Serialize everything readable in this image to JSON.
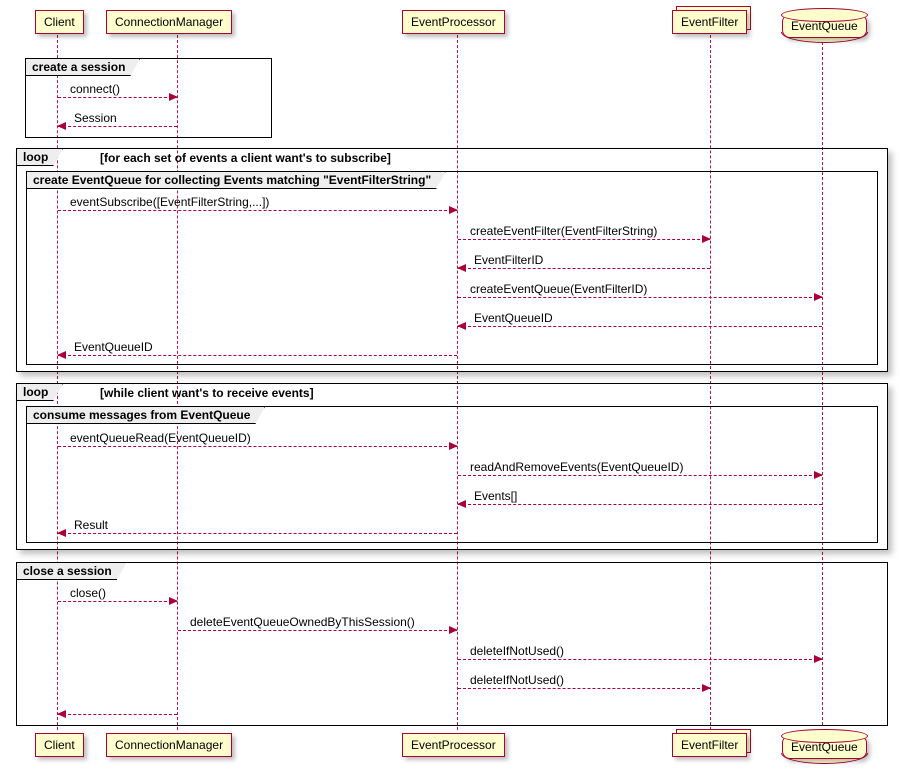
{
  "participants": {
    "client": "Client",
    "connection_manager": "ConnectionManager",
    "event_processor": "EventProcessor",
    "event_filter": "EventFilter",
    "event_queue": "EventQueue"
  },
  "groups": {
    "g1": {
      "label": "create a session"
    },
    "g2": {
      "label": "loop",
      "cond": "[for each set of events a client want's to subscribe]"
    },
    "g3": {
      "label": "create EventQueue for collecting Events matching \"EventFilterString\""
    },
    "g4": {
      "label": "loop",
      "cond": "[while client want's to receive events]"
    },
    "g5": {
      "label": "consume messages from EventQueue"
    },
    "g6": {
      "label": "close a session"
    }
  },
  "messages": {
    "m1": "connect()",
    "m2": "Session",
    "m3": "eventSubscribe([EventFilterString,...])",
    "m4": "createEventFilter(EventFilterString)",
    "m5": "EventFilterID",
    "m6": "createEventQueue(EventFilterID)",
    "m7": "EventQueueID",
    "m8": "EventQueueID",
    "m9": "eventQueueRead(EventQueueID)",
    "m10": "readAndRemoveEvents(EventQueueID)",
    "m11": "Events[]",
    "m12": "Result",
    "m13": "close()",
    "m14": "deleteEventQueueOwnedByThisSession()",
    "m15": "deleteIfNotUsed()",
    "m16": "deleteIfNotUsed()"
  },
  "chart_data": {
    "type": "uml-sequence-diagram",
    "participants": [
      "Client",
      "ConnectionManager",
      "EventProcessor",
      "EventFilter",
      "EventQueue"
    ],
    "interactions": [
      {
        "group": "create a session",
        "messages": [
          {
            "from": "Client",
            "to": "ConnectionManager",
            "label": "connect()"
          },
          {
            "from": "ConnectionManager",
            "to": "Client",
            "label": "Session",
            "return": true
          }
        ]
      },
      {
        "group": "loop",
        "cond": "for each set of events a client want's to subscribe",
        "messages": [
          {
            "group": "create EventQueue for collecting Events matching \"EventFilterString\"",
            "messages": [
              {
                "from": "Client",
                "to": "EventProcessor",
                "label": "eventSubscribe([EventFilterString,...])"
              },
              {
                "from": "EventProcessor",
                "to": "EventFilter",
                "label": "createEventFilter(EventFilterString)"
              },
              {
                "from": "EventFilter",
                "to": "EventProcessor",
                "label": "EventFilterID",
                "return": true
              },
              {
                "from": "EventProcessor",
                "to": "EventQueue",
                "label": "createEventQueue(EventFilterID)"
              },
              {
                "from": "EventQueue",
                "to": "EventProcessor",
                "label": "EventQueueID",
                "return": true
              },
              {
                "from": "EventProcessor",
                "to": "Client",
                "label": "EventQueueID",
                "return": true
              }
            ]
          }
        ]
      },
      {
        "group": "loop",
        "cond": "while client want's to receive events",
        "messages": [
          {
            "group": "consume messages from EventQueue",
            "messages": [
              {
                "from": "Client",
                "to": "EventProcessor",
                "label": "eventQueueRead(EventQueueID)"
              },
              {
                "from": "EventProcessor",
                "to": "EventQueue",
                "label": "readAndRemoveEvents(EventQueueID)"
              },
              {
                "from": "EventQueue",
                "to": "EventProcessor",
                "label": "Events[]",
                "return": true
              },
              {
                "from": "EventProcessor",
                "to": "Client",
                "label": "Result",
                "return": true
              }
            ]
          }
        ]
      },
      {
        "group": "close a session",
        "messages": [
          {
            "from": "Client",
            "to": "ConnectionManager",
            "label": "close()"
          },
          {
            "from": "ConnectionManager",
            "to": "EventProcessor",
            "label": "deleteEventQueueOwnedByThisSession()"
          },
          {
            "from": "EventProcessor",
            "to": "EventQueue",
            "label": "deleteIfNotUsed()"
          },
          {
            "from": "EventProcessor",
            "to": "EventFilter",
            "label": "deleteIfNotUsed()"
          },
          {
            "from": "ConnectionManager",
            "to": "Client",
            "label": "",
            "return": true
          }
        ]
      }
    ]
  }
}
